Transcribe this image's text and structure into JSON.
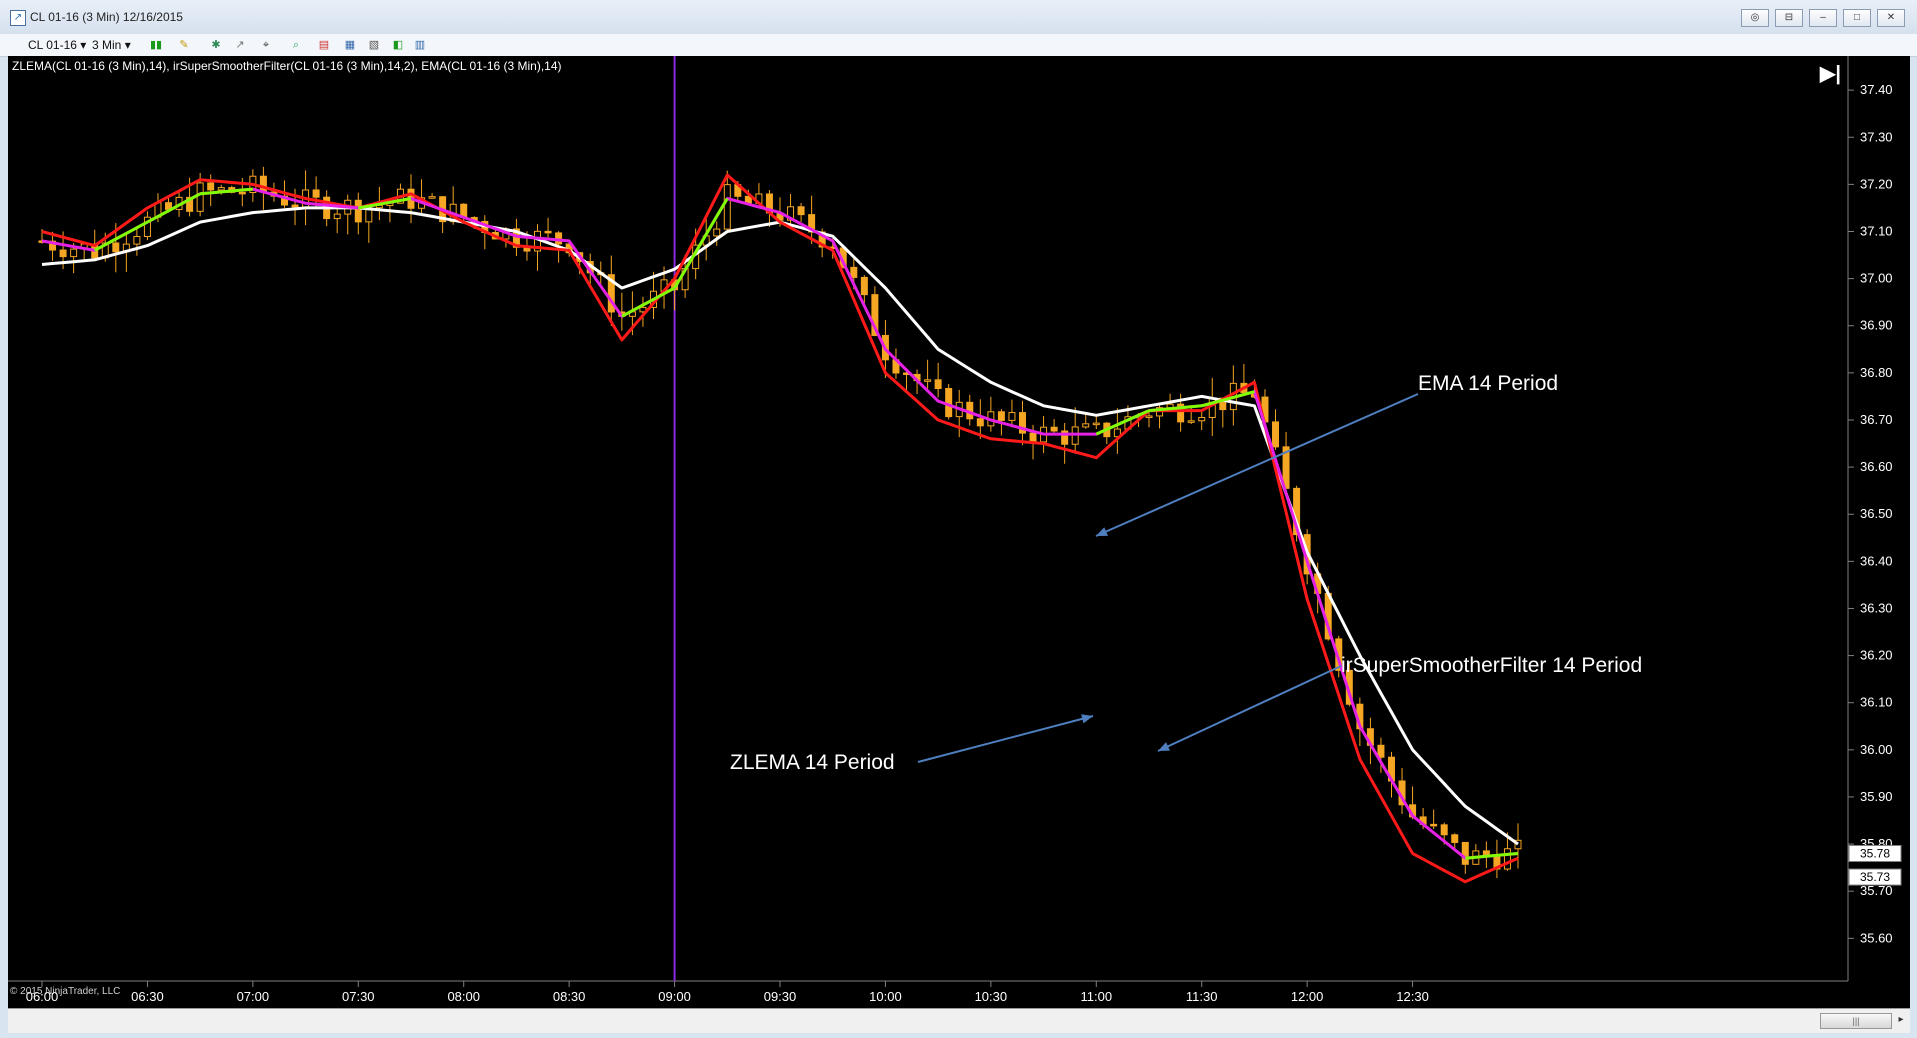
{
  "window": {
    "title": "CL 01-16 (3 Min)  12/16/2015",
    "buttons": [
      "◎",
      "⊟",
      "–",
      "□",
      "✕"
    ]
  },
  "toolbar": {
    "instrument": "CL 01-16",
    "interval": "3 Min"
  },
  "chart": {
    "indicator_label": "ZLEMA(CL 01-16 (3 Min),14), irSuperSmootherFilter(CL 01-16 (3 Min),14,2), EMA(CL 01-16 (3 Min),14)",
    "copyright": "© 2015 NinjaTrader, LLC",
    "go_to_end_icon": "▶|",
    "price_badges": [
      "35.78",
      "35.73"
    ],
    "annotations": {
      "ema": "EMA 14 Period",
      "super": "irSuperSmootherFilter 14 Period",
      "zlema": "ZLEMA 14 Period"
    },
    "colors": {
      "background": "#000000",
      "candle": "#f5a623",
      "ema": "#ffffff",
      "zlema": "#ff1a1a",
      "super": "#e621e6",
      "super_up": "#7fff00",
      "session_line": "#8a2be2",
      "annotation_arrow": "#4f7fbf"
    }
  },
  "chart_data": {
    "type": "candlestick",
    "xlabel": "",
    "ylabel": "",
    "x_ticks": [
      "06:00",
      "06:30",
      "07:00",
      "07:30",
      "08:00",
      "08:30",
      "09:00",
      "09:30",
      "10:00",
      "10:30",
      "11:00",
      "11:30",
      "12:00",
      "12:30"
    ],
    "y_ticks": [
      "37.40",
      "37.30",
      "37.20",
      "37.10",
      "37.00",
      "36.90",
      "36.80",
      "36.70",
      "36.60",
      "36.50",
      "36.40",
      "36.30",
      "36.20",
      "36.10",
      "36.00",
      "35.90",
      "35.80",
      "35.70",
      "35.60"
    ],
    "ylim": [
      35.52,
      37.43
    ],
    "x_minutes_range": [
      0,
      420
    ],
    "session_break": "09:00",
    "series": [
      {
        "name": "EMA 14 Period",
        "key": "ema",
        "points": [
          [
            0,
            37.03
          ],
          [
            15,
            37.04
          ],
          [
            30,
            37.07
          ],
          [
            45,
            37.12
          ],
          [
            60,
            37.14
          ],
          [
            75,
            37.15
          ],
          [
            90,
            37.15
          ],
          [
            105,
            37.14
          ],
          [
            120,
            37.12
          ],
          [
            135,
            37.1
          ],
          [
            150,
            37.06
          ],
          [
            165,
            36.98
          ],
          [
            180,
            37.02
          ],
          [
            195,
            37.1
          ],
          [
            210,
            37.12
          ],
          [
            225,
            37.09
          ],
          [
            240,
            36.98
          ],
          [
            255,
            36.85
          ],
          [
            270,
            36.78
          ],
          [
            285,
            36.73
          ],
          [
            300,
            36.71
          ],
          [
            315,
            36.73
          ],
          [
            330,
            36.75
          ],
          [
            345,
            36.73
          ],
          [
            360,
            36.42
          ],
          [
            375,
            36.2
          ],
          [
            390,
            36.0
          ],
          [
            405,
            35.88
          ],
          [
            420,
            35.8
          ]
        ]
      },
      {
        "name": "ZLEMA 14 Period",
        "key": "zlema",
        "points": [
          [
            0,
            37.1
          ],
          [
            15,
            37.07
          ],
          [
            30,
            37.15
          ],
          [
            45,
            37.21
          ],
          [
            60,
            37.2
          ],
          [
            75,
            37.17
          ],
          [
            90,
            37.15
          ],
          [
            105,
            37.18
          ],
          [
            120,
            37.12
          ],
          [
            135,
            37.07
          ],
          [
            150,
            37.06
          ],
          [
            165,
            36.87
          ],
          [
            180,
            37.0
          ],
          [
            195,
            37.22
          ],
          [
            210,
            37.12
          ],
          [
            225,
            37.06
          ],
          [
            240,
            36.8
          ],
          [
            255,
            36.7
          ],
          [
            270,
            36.66
          ],
          [
            285,
            36.65
          ],
          [
            300,
            36.62
          ],
          [
            315,
            36.72
          ],
          [
            330,
            36.72
          ],
          [
            345,
            36.78
          ],
          [
            360,
            36.32
          ],
          [
            375,
            35.98
          ],
          [
            390,
            35.78
          ],
          [
            405,
            35.72
          ],
          [
            420,
            35.77
          ]
        ]
      },
      {
        "name": "irSuperSmootherFilter 14 Period",
        "key": "super",
        "points": [
          [
            0,
            37.08
          ],
          [
            15,
            37.06
          ],
          [
            30,
            37.12
          ],
          [
            45,
            37.18
          ],
          [
            60,
            37.19
          ],
          [
            75,
            37.16
          ],
          [
            90,
            37.15
          ],
          [
            105,
            37.17
          ],
          [
            120,
            37.13
          ],
          [
            135,
            37.09
          ],
          [
            150,
            37.08
          ],
          [
            165,
            36.92
          ],
          [
            180,
            36.98
          ],
          [
            195,
            37.17
          ],
          [
            210,
            37.14
          ],
          [
            225,
            37.08
          ],
          [
            240,
            36.85
          ],
          [
            255,
            36.74
          ],
          [
            270,
            36.7
          ],
          [
            285,
            36.67
          ],
          [
            300,
            36.67
          ],
          [
            315,
            36.72
          ],
          [
            330,
            36.73
          ],
          [
            345,
            36.76
          ],
          [
            360,
            36.4
          ],
          [
            375,
            36.05
          ],
          [
            390,
            35.86
          ],
          [
            405,
            35.77
          ],
          [
            420,
            35.78
          ]
        ]
      }
    ]
  }
}
